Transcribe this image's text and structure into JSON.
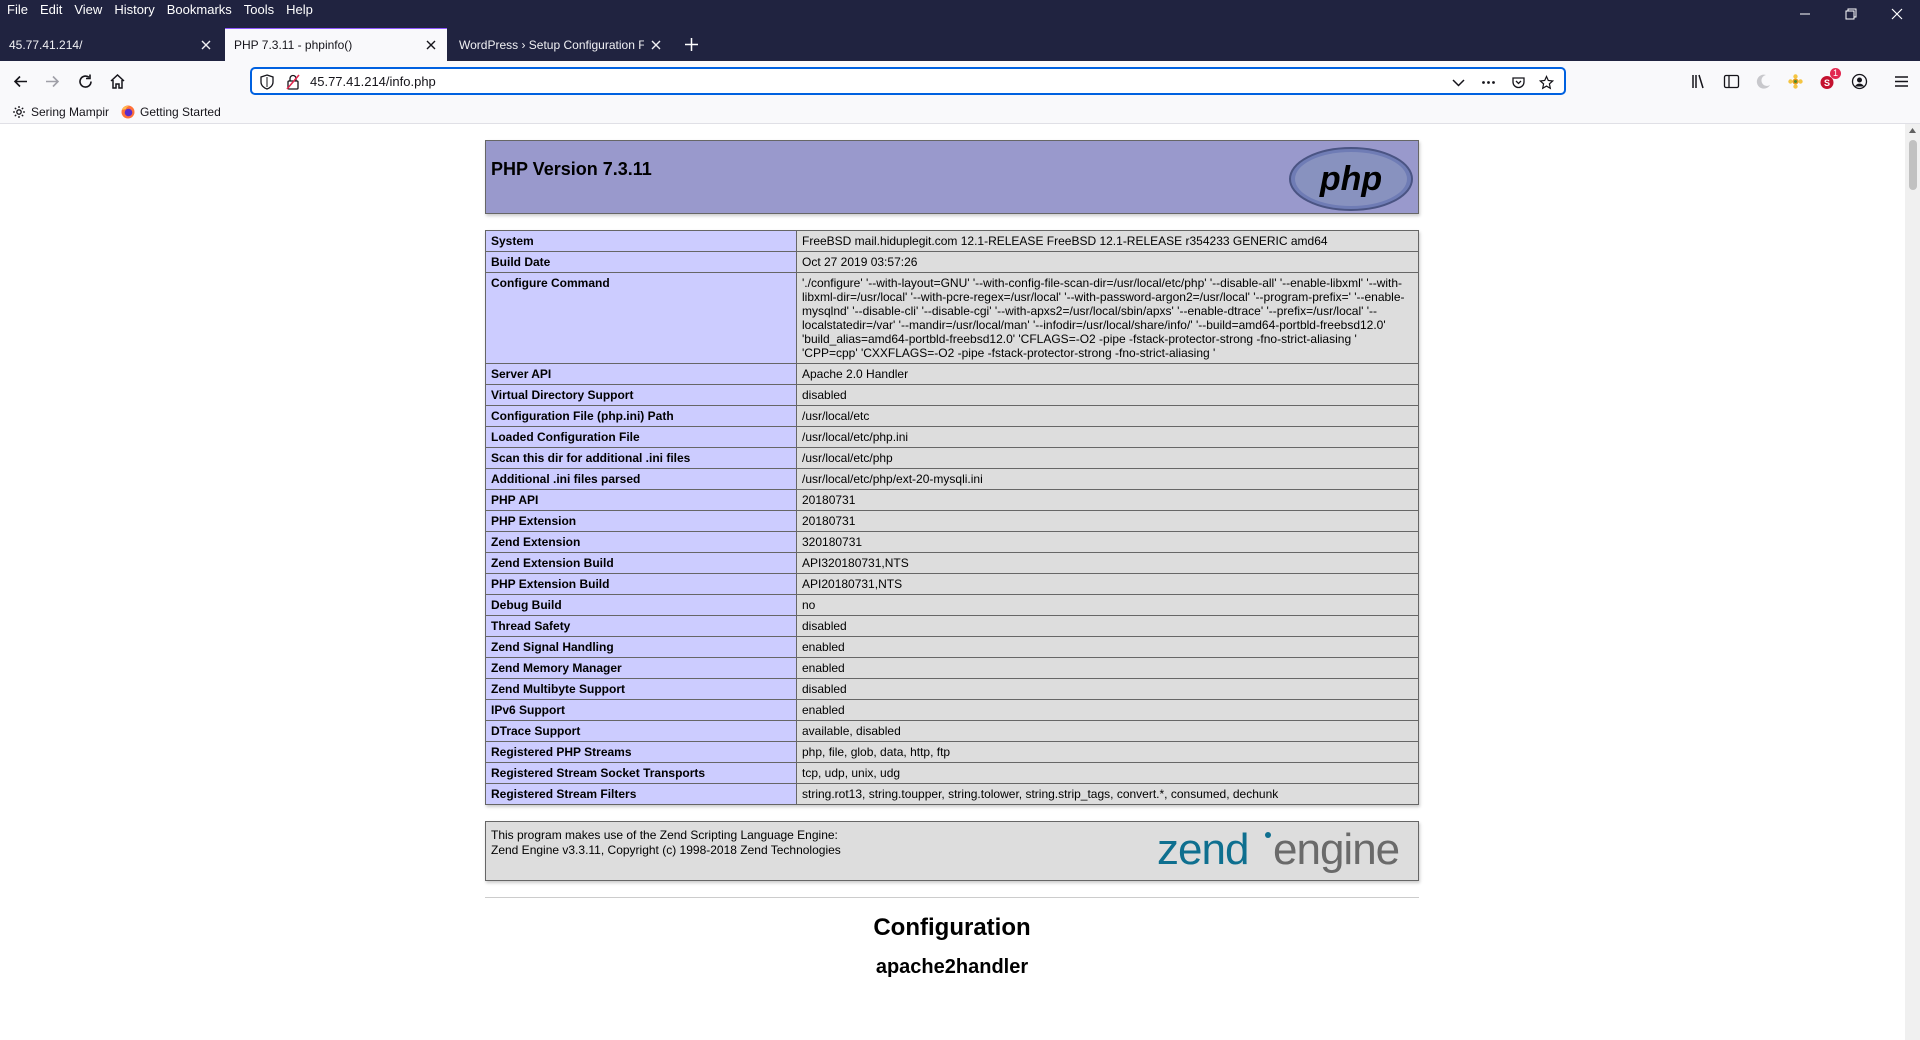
{
  "browser": {
    "menu": [
      "File",
      "Edit",
      "View",
      "History",
      "Bookmarks",
      "Tools",
      "Help"
    ],
    "tabs": [
      {
        "title": "45.77.41.214/"
      },
      {
        "title": "PHP 7.3.11 - phpinfo()"
      },
      {
        "title": "WordPress › Setup Configuration Fi"
      }
    ],
    "url": "45.77.41.214/info.php",
    "bookmarks": [
      {
        "label": "Sering Mampir"
      },
      {
        "label": "Getting Started"
      }
    ],
    "notification_badge": "1",
    "accent_color": "#0061e0"
  },
  "page": {
    "php_version": "PHP Version 7.3.11",
    "info_rows": [
      {
        "key": "System",
        "value": "FreeBSD mail.hiduplegit.com 12.1-RELEASE FreeBSD 12.1-RELEASE r354233 GENERIC amd64"
      },
      {
        "key": "Build Date",
        "value": "Oct 27 2019 03:57:26"
      },
      {
        "key": "Configure Command",
        "value": "'./configure' '--with-layout=GNU' '--with-config-file-scan-dir=/usr/local/etc/php' '--disable-all' '--enable-libxml' '--with-libxml-dir=/usr/local' '--with-pcre-regex=/usr/local' '--with-password-argon2=/usr/local' '--program-prefix=' '--enable-mysqlnd' '--disable-cli' '--disable-cgi' '--with-apxs2=/usr/local/sbin/apxs' '--enable-dtrace' '--prefix=/usr/local' '--localstatedir=/var' '--mandir=/usr/local/man' '--infodir=/usr/local/share/info/' '--build=amd64-portbld-freebsd12.0' 'build_alias=amd64-portbld-freebsd12.0' 'CFLAGS=-O2 -pipe -fstack-protector-strong -fno-strict-aliasing ' 'CPP=cpp' 'CXXFLAGS=-O2 -pipe -fstack-protector-strong -fno-strict-aliasing '"
      },
      {
        "key": "Server API",
        "value": "Apache 2.0 Handler"
      },
      {
        "key": "Virtual Directory Support",
        "value": "disabled"
      },
      {
        "key": "Configuration File (php.ini) Path",
        "value": "/usr/local/etc"
      },
      {
        "key": "Loaded Configuration File",
        "value": "/usr/local/etc/php.ini"
      },
      {
        "key": "Scan this dir for additional .ini files",
        "value": "/usr/local/etc/php"
      },
      {
        "key": "Additional .ini files parsed",
        "value": "/usr/local/etc/php/ext-20-mysqli.ini"
      },
      {
        "key": "PHP API",
        "value": "20180731"
      },
      {
        "key": "PHP Extension",
        "value": "20180731"
      },
      {
        "key": "Zend Extension",
        "value": "320180731"
      },
      {
        "key": "Zend Extension Build",
        "value": "API320180731,NTS"
      },
      {
        "key": "PHP Extension Build",
        "value": "API20180731,NTS"
      },
      {
        "key": "Debug Build",
        "value": "no"
      },
      {
        "key": "Thread Safety",
        "value": "disabled"
      },
      {
        "key": "Zend Signal Handling",
        "value": "enabled"
      },
      {
        "key": "Zend Memory Manager",
        "value": "enabled"
      },
      {
        "key": "Zend Multibyte Support",
        "value": "disabled"
      },
      {
        "key": "IPv6 Support",
        "value": "enabled"
      },
      {
        "key": "DTrace Support",
        "value": "available, disabled"
      },
      {
        "key": "Registered PHP Streams",
        "value": "php, file, glob, data, http, ftp"
      },
      {
        "key": "Registered Stream Socket Transports",
        "value": "tcp, udp, unix, udg"
      },
      {
        "key": "Registered Stream Filters",
        "value": "string.rot13, string.toupper, string.tolower, string.strip_tags, convert.*, consumed, dechunk"
      }
    ],
    "zend_line1": "This program makes use of the Zend Scripting Language Engine:",
    "zend_line2": "Zend Engine v3.3.11, Copyright (c) 1998-2018 Zend Technologies",
    "configuration_heading": "Configuration",
    "next_section_heading": "apache2handler"
  }
}
